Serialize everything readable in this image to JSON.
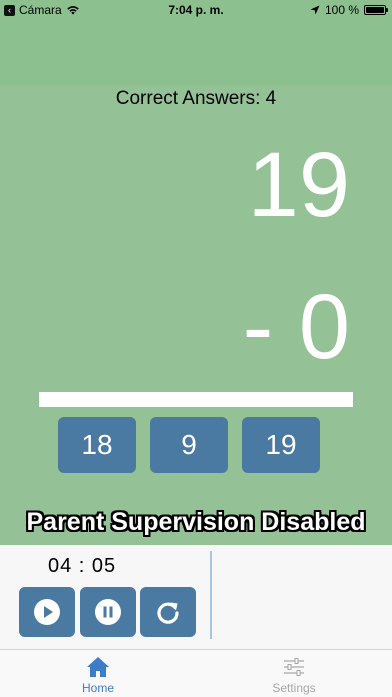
{
  "status_bar": {
    "back_app": "Cámara",
    "time": "7:04 p. m.",
    "battery": "100 %"
  },
  "game": {
    "correct_label": "Correct Answers: 4",
    "top_number": "19",
    "bottom_number": "- 0",
    "answers": [
      "18",
      "9",
      "19"
    ],
    "supervision_text": "Parent Supervision Disabled"
  },
  "timer": {
    "time": "04 : 05",
    "buttons": [
      "play-icon",
      "pause-icon",
      "restart-icon"
    ]
  },
  "tabs": [
    {
      "label": "Home",
      "icon": "home-icon",
      "active": true
    },
    {
      "label": "Settings",
      "icon": "sliders-icon",
      "active": false
    }
  ],
  "colors": {
    "background": "#94c195",
    "header": "#8cc08e",
    "button": "#4a7aa2",
    "active_tab": "#3d7cc9",
    "inactive_tab": "#a7a7a7"
  }
}
